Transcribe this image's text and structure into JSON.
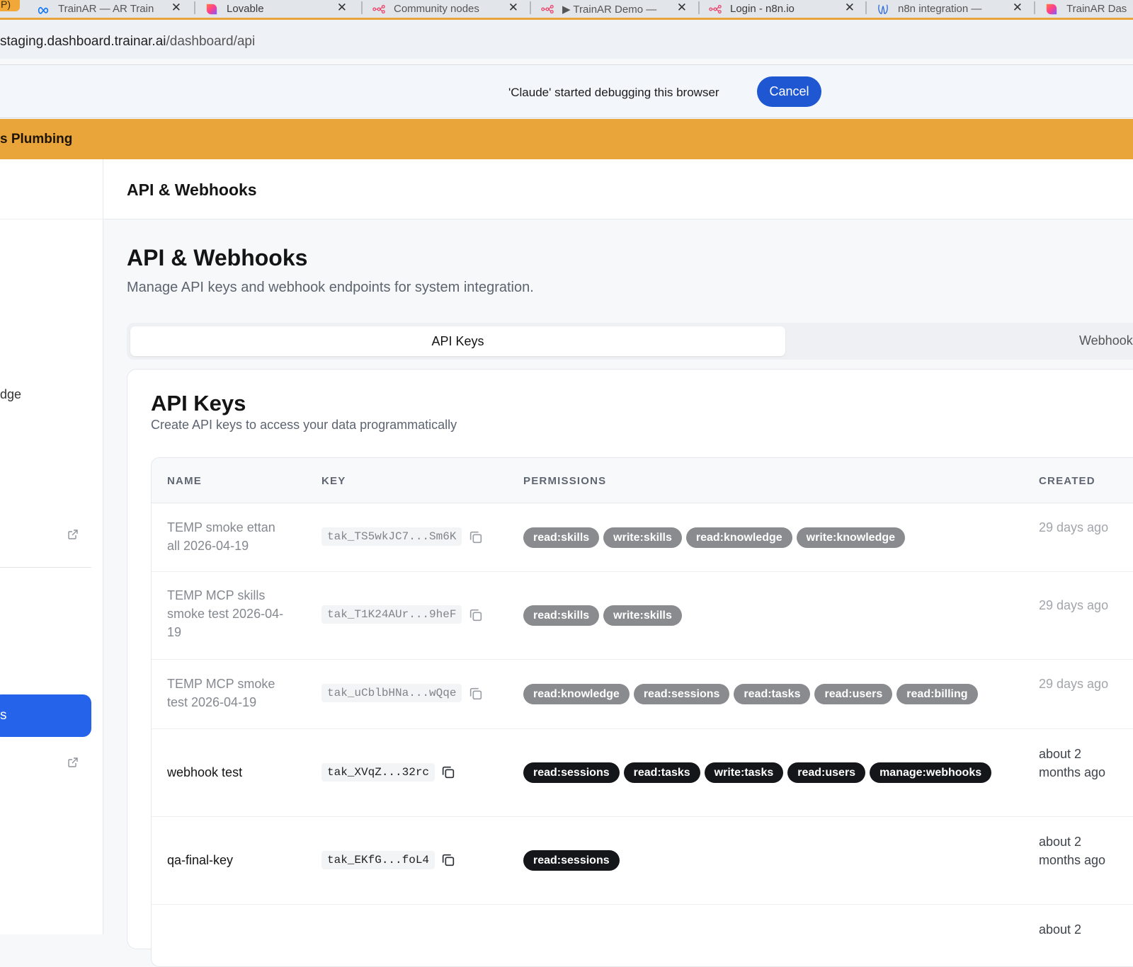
{
  "browser": {
    "tabs": [
      {
        "label": "P)",
        "type": "pinned"
      },
      {
        "label": "TrainAR — AR Train",
        "icon": "meta-infinity-icon"
      },
      {
        "label": "Lovable",
        "icon": "lovable-heart-icon"
      },
      {
        "label": "Community nodes",
        "icon": "n8n-icon"
      },
      {
        "label": "▶ TrainAR Demo —",
        "icon": "n8n-icon"
      },
      {
        "label": "Login - n8n.io",
        "icon": "n8n-icon"
      },
      {
        "label": "n8n integration —",
        "icon": "claude-icon"
      },
      {
        "label": "TrainAR Das",
        "icon": "lovable-heart-icon"
      }
    ],
    "url_host": "staging.dashboard.trainar.ai",
    "url_path": "/dashboard/api"
  },
  "debug_bar": {
    "message": "'Claude' started debugging this browser",
    "cancel_label": "Cancel"
  },
  "org_banner": {
    "name": "s Plumbing"
  },
  "sidebar": {
    "knowledge_label": "dge",
    "active_label": "s"
  },
  "header": {
    "title": "API & Webhooks"
  },
  "main": {
    "title": "API & Webhooks",
    "subtitle": "Manage API keys and webhook endpoints for system integration.",
    "tabs": {
      "api_keys": "API Keys",
      "webhooks": "Webhooks"
    }
  },
  "api_keys_card": {
    "title": "API Keys",
    "subtitle": "Create API keys to access your data programmatically",
    "columns": {
      "name": "NAME",
      "key": "KEY",
      "permissions": "PERMISSIONS",
      "created": "CREATED"
    },
    "rows": [
      {
        "name": "TEMP smoke ettan all 2026-04-19",
        "key": "tak_TS5wkJC7...Sm6K",
        "permissions": [
          "read:skills",
          "write:skills",
          "read:knowledge",
          "write:knowledge"
        ],
        "created": "29 days ago"
      },
      {
        "name": "TEMP MCP skills smoke test 2026-04-19",
        "key": "tak_T1K24AUr...9heF",
        "permissions": [
          "read:skills",
          "write:skills"
        ],
        "created": "29 days ago"
      },
      {
        "name": "TEMP MCP smoke test 2026-04-19",
        "key": "tak_uCblbHNa...wQqe",
        "permissions": [
          "read:knowledge",
          "read:sessions",
          "read:tasks",
          "read:users",
          "read:billing"
        ],
        "created": "29 days ago"
      },
      {
        "name": "webhook test",
        "key": "tak_XVqZ...32rc",
        "permissions": [
          "read:sessions",
          "read:tasks",
          "write:tasks",
          "read:users",
          "manage:webhooks"
        ],
        "created": "about 2 months ago"
      },
      {
        "name": "qa-final-key",
        "key": "tak_EKfG...foL4",
        "permissions": [
          "read:sessions"
        ],
        "created": "about 2 months ago"
      },
      {
        "created": "about 2"
      }
    ]
  },
  "colors": {
    "banner": "#e9a43a",
    "primary": "#2563eb",
    "cancel": "#1e57d1",
    "badge_active": "#15161a",
    "badge_dim": "#8a8b8e"
  }
}
